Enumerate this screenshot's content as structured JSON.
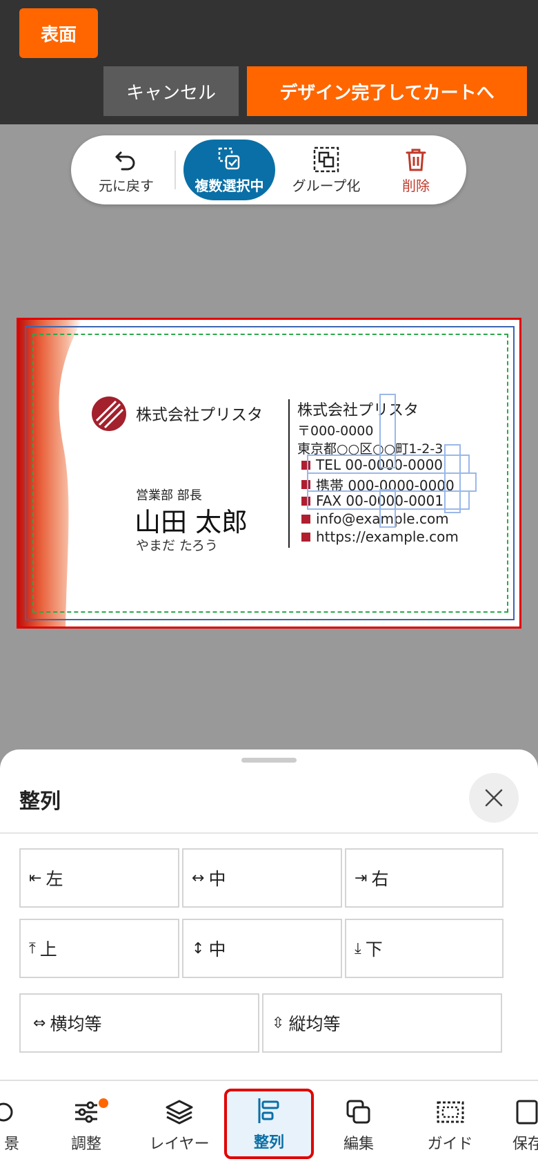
{
  "header": {
    "side_label": "表面",
    "cancel_label": "キャンセル",
    "complete_label": "デザイン完了してカートへ"
  },
  "toolbar": {
    "undo_label": "元に戻す",
    "multi_select_label": "複数選択中",
    "group_label": "グループ化",
    "delete_label": "削除"
  },
  "card": {
    "company_left": "株式会社プリスタ",
    "department": "営業部 部長",
    "name": "山田 太郎",
    "name_kana": "やまだ たろう",
    "company_right": "株式会社プリスタ",
    "postal": "〒000-0000",
    "address": "東京都○○区○○町1-2-3",
    "info": [
      "TEL 00-0000-0000",
      "携帯 000-0000-0000",
      "FAX 00-0000-0001",
      "info@example.com",
      "https://example.com"
    ]
  },
  "sheet": {
    "title": "整列",
    "buttons": [
      {
        "icon": "⇤",
        "label": "左"
      },
      {
        "icon": "↔",
        "label": "中"
      },
      {
        "icon": "⇥",
        "label": "右"
      },
      {
        "icon": "⤒",
        "label": "上"
      },
      {
        "icon": "↕",
        "label": "中"
      },
      {
        "icon": "⤓",
        "label": "下"
      },
      {
        "icon": "⇔",
        "label": "横均等"
      },
      {
        "icon": "⇳",
        "label": "縦均等"
      }
    ]
  },
  "bottom_nav": {
    "items": [
      {
        "label": "景",
        "icon": "background-icon"
      },
      {
        "label": "調整",
        "icon": "sliders-icon"
      },
      {
        "label": "レイヤー",
        "icon": "layers-icon"
      },
      {
        "label": "整列",
        "icon": "align-icon",
        "active": true
      },
      {
        "label": "編集",
        "icon": "copy-icon"
      },
      {
        "label": "ガイド",
        "icon": "guide-icon"
      },
      {
        "label": "保存",
        "icon": "save-icon"
      }
    ]
  },
  "colors": {
    "accent": "#ff6600",
    "active_blue": "#0a6fa6",
    "delete_red": "#c0392b",
    "highlight_red": "#e00000"
  }
}
